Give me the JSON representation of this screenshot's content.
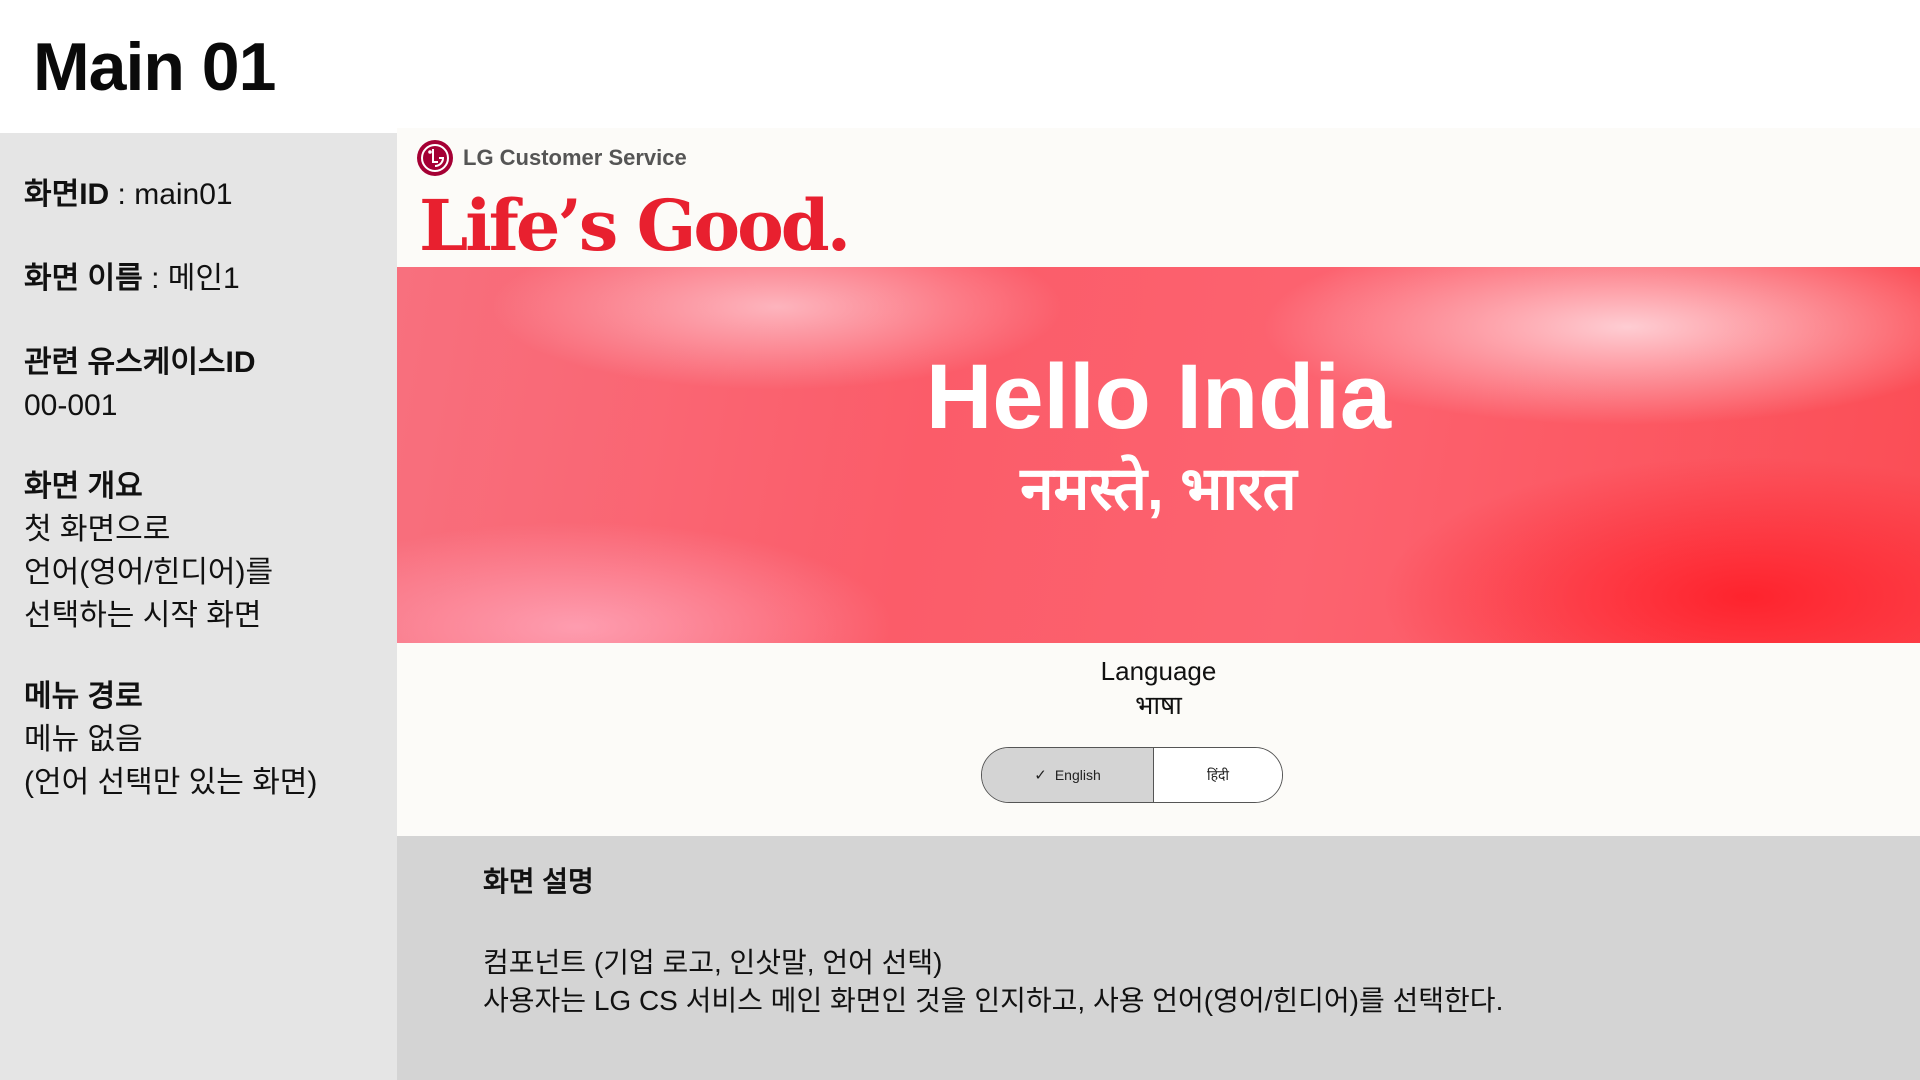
{
  "page": {
    "title": "Main 01"
  },
  "spec": {
    "screen_id_key": "화면ID",
    "screen_id_value": " : main01",
    "screen_name_key": "화면 이름",
    "screen_name_value": " : 메인1",
    "usecase_key": "관련 유스케이스ID",
    "usecase_value": "00-001",
    "overview_key": "화면 개요",
    "overview_lines": [
      "첫 화면으로",
      "언어(영어/힌디어)를",
      "선택하는 시작 화면"
    ],
    "menu_key": "메뉴 경로",
    "menu_lines": [
      "메뉴 없음",
      "(언어 선택만 있는 화면)"
    ]
  },
  "mockup": {
    "brand": "LG Customer Service",
    "logo_icon": "lg-logo-icon",
    "slogan": "Life’s Good.",
    "hero_en": "Hello India",
    "hero_hi": "नमस्ते, भारत",
    "language_label_en": "Language",
    "language_label_hi": "भाषा",
    "options": {
      "selected_check": "✓",
      "english": "English",
      "hindi": "हिंदी"
    },
    "colors": {
      "slogan": "#e8202f",
      "logo": "#a50034",
      "hero": "#fb5c69"
    }
  },
  "description": {
    "title": "화면 설명",
    "line1": "컴포넌트 (기업 로고, 인삿말, 언어 선택)",
    "line2": "사용자는 LG CS 서비스 메인 화면인 것을 인지하고, 사용 언어(영어/힌디어)를 선택한다."
  }
}
